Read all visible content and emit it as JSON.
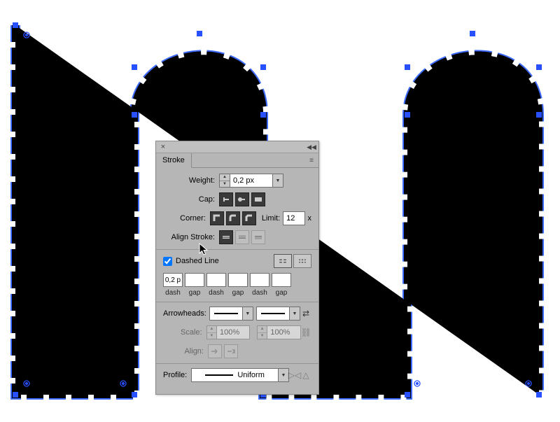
{
  "panel": {
    "title": "Stroke",
    "weight_label": "Weight:",
    "weight_value": "0,2 px",
    "cap_label": "Cap:",
    "corner_label": "Corner:",
    "limit_label": "Limit:",
    "limit_value": "12",
    "limit_unit": "x",
    "align_label": "Align Stroke:",
    "dashed_label": "Dashed Line",
    "dashed_checked": true,
    "dash_slots": [
      {
        "label": "dash",
        "value": "0,2 p"
      },
      {
        "label": "gap",
        "value": ""
      },
      {
        "label": "dash",
        "value": ""
      },
      {
        "label": "gap",
        "value": ""
      },
      {
        "label": "dash",
        "value": ""
      },
      {
        "label": "gap",
        "value": ""
      }
    ],
    "arrowheads_label": "Arrowheads:",
    "scale_label": "Scale:",
    "scale_value": "100%",
    "align_arrow_label": "Align:",
    "profile_label": "Profile:",
    "profile_value": "Uniform"
  }
}
